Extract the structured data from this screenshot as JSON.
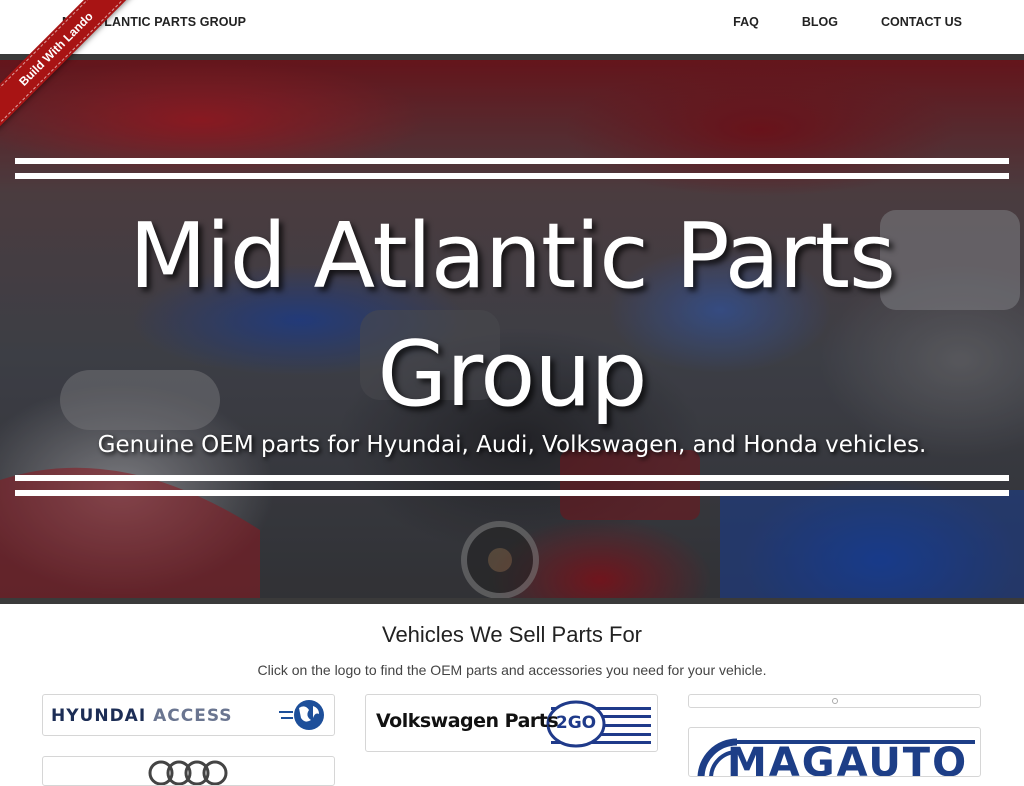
{
  "header": {
    "brand": "MID ATLANTIC PARTS GROUP",
    "nav": [
      {
        "label": "FAQ"
      },
      {
        "label": "BLOG"
      },
      {
        "label": "CONTACT US"
      }
    ]
  },
  "ribbon": {
    "label": "Build With Lando"
  },
  "hero": {
    "title": "Mid Atlantic Parts Group",
    "subtitle": "Genuine OEM parts for Hyundai, Audi, Volkswagen, and Honda vehicles."
  },
  "vehicles": {
    "title": "Vehicles We Sell Parts For",
    "subtitle": "Click on the logo to find the OEM parts and accessories you need for your vehicle.",
    "logos": [
      {
        "brand": "HYUNDAI",
        "suffix": "ACCESS"
      },
      {
        "brand": "Volkswagen Parts",
        "badge": "2GO"
      },
      {
        "brand": "MAGAUTO"
      }
    ]
  },
  "colors": {
    "ribbon": "#a81414",
    "nav_border": "#3a3a3a",
    "hyundai_navy": "#1c2d55",
    "vw_blue": "#1f3a8a",
    "magauto_blue": "#1d3e87"
  }
}
